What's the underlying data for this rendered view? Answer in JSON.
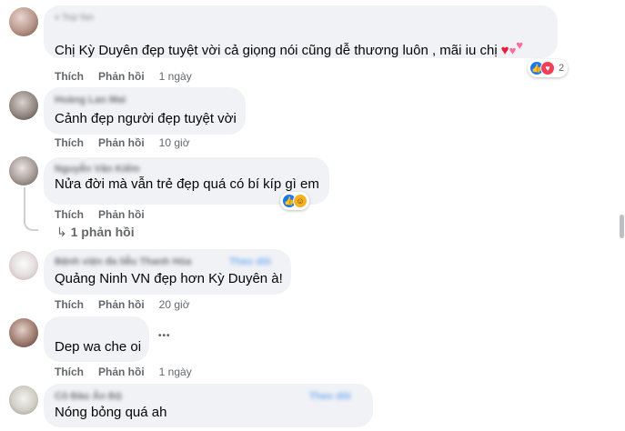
{
  "comments": [
    {
      "badge": "Top fan",
      "text": "Chị Kỳ Duyên đẹp tuyệt vời cả giọng nói cũng dễ thương luôn , mãi iu chị",
      "emoji": [
        "heart",
        "heart",
        "heart"
      ],
      "like_label": "Thích",
      "reply_label": "Phản hồi",
      "time": "1 ngày",
      "reaction_count": "2"
    },
    {
      "name": "Hoàng Lan Mai",
      "text": "Cảnh đẹp người đẹp tuyệt vời",
      "like_label": "Thích",
      "reply_label": "Phản hồi",
      "time": "10 giờ"
    },
    {
      "name": "Nguyễn Văn Kiểm",
      "text": "Nửa đời mà vẫn trẻ đẹp quá có bí kíp gì em",
      "like_label": "Thích",
      "reply_label": "Phản hồi",
      "time": "",
      "replies_label": "1 phản hồi"
    },
    {
      "name": "Bệnh viện đa liễu Thanh Hóa",
      "follow_label": "Theo dõi",
      "text": "Quảng Ninh VN đẹp hơn Kỳ Duyên à!",
      "like_label": "Thích",
      "reply_label": "Phản hồi",
      "time": "20 giờ"
    },
    {
      "name": "",
      "text": "Dep wa che oi",
      "like_label": "Thích",
      "reply_label": "Phản hồi",
      "time": "1 ngày",
      "more_label": "•••"
    },
    {
      "name": "Cô Đào Ấn Độ",
      "follow_label": "Theo dõi",
      "text": "Nóng bỏng quá ah"
    }
  ],
  "icons": {
    "like": "like-reaction-icon",
    "love": "love-reaction-icon",
    "haha": "haha-reaction-icon",
    "reply_arrow": "reply-arrow-icon"
  },
  "colors": {
    "bubble": "#f0f2f5",
    "secondary_text": "#65676b",
    "link": "#1877f2",
    "like": "#1877f2",
    "love": "#f33e58",
    "haha": "#f7b125"
  }
}
